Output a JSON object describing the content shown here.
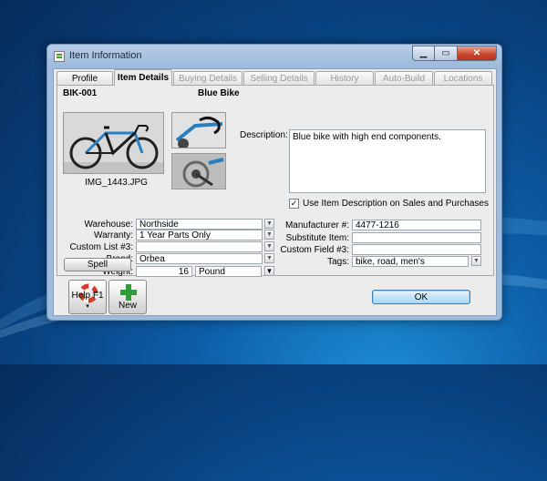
{
  "window": {
    "title": "Item Information",
    "icon": "item-window-icon"
  },
  "tabs": [
    {
      "label": "Profile",
      "active": false,
      "enabled": true
    },
    {
      "label": "Item Details",
      "active": true,
      "enabled": true
    },
    {
      "label": "Buying Details",
      "active": false,
      "enabled": false
    },
    {
      "label": "Selling Details",
      "active": false,
      "enabled": false
    },
    {
      "label": "History",
      "active": false,
      "enabled": false
    },
    {
      "label": "Auto-Build",
      "active": false,
      "enabled": false
    },
    {
      "label": "Locations",
      "active": false,
      "enabled": false
    }
  ],
  "item": {
    "number": "BIK-001",
    "name": "Blue Bike",
    "image_caption": "IMG_1443.JPG"
  },
  "description": {
    "label": "Description:",
    "value": "Blue bike with high end components."
  },
  "use_description": {
    "label": "Use Item Description on Sales and Purchases",
    "checked": true
  },
  "left_fields": {
    "warehouse": {
      "label": "Warehouse:",
      "value": "Northside"
    },
    "warranty": {
      "label": "Warranty:",
      "value": "1 Year Parts Only"
    },
    "custom_list_3": {
      "label": "Custom List #3:",
      "value": ""
    },
    "brand": {
      "label": "Brand:",
      "value": "Orbea"
    },
    "weight": {
      "label": "Weight:",
      "value": "16",
      "unit": "Pound"
    }
  },
  "right_fields": {
    "manufacturer": {
      "label": "Manufacturer #:",
      "value": "4477-1216"
    },
    "substitute": {
      "label": "Substitute Item:",
      "value": ""
    },
    "custom_field_3": {
      "label": "Custom Field #3:",
      "value": ""
    },
    "tags": {
      "label": "Tags:",
      "value": "bike, road, men's"
    }
  },
  "buttons": {
    "spell": "Spell",
    "help": "Help F1",
    "new": "New",
    "ok": "OK"
  },
  "colors": {
    "desktop": "#0d5ea8",
    "ok_button": "#a9d8f6",
    "new_plus": "#2e9e3a",
    "help_ring": "#d43a2a"
  }
}
